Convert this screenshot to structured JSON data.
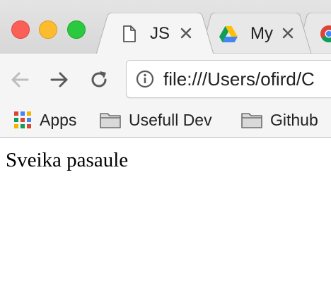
{
  "window": {
    "traffic_lights": [
      "close",
      "minimize",
      "zoom"
    ]
  },
  "tabs": [
    {
      "title": "JS",
      "icon": "document-icon",
      "active": true
    },
    {
      "title": "My",
      "icon": "google-drive-icon",
      "active": false
    },
    {
      "title": "",
      "icon": "google-chrome-icon",
      "active": false
    }
  ],
  "toolbar": {
    "url": "file:///Users/ofird/C",
    "url_icon": "info-icon"
  },
  "bookmarks": [
    {
      "label": "Apps",
      "icon": "apps-grid-icon"
    },
    {
      "label": "Usefull Dev",
      "icon": "folder-icon"
    },
    {
      "label": "Github",
      "icon": "folder-icon"
    }
  ],
  "page": {
    "text": "Sveika pasaule"
  },
  "colors": {
    "close": "#fc5f57",
    "minimize": "#fdbb2e",
    "zoom": "#2ac940",
    "chrome_bg": "#f5f5f5",
    "tabstrip_bg": "#dedede"
  }
}
